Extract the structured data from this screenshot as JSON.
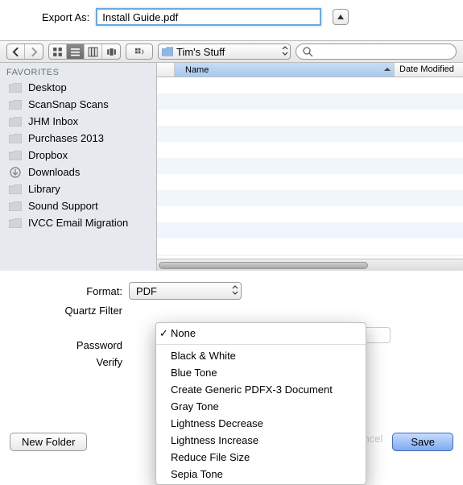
{
  "header": {
    "export_label": "Export As:",
    "filename": "Install Guide.pdf"
  },
  "toolbar": {
    "path_folder": "Tim's Stuff"
  },
  "sidebar": {
    "section_label": "FAVORITES",
    "items": [
      {
        "label": "Desktop",
        "icon": "folder"
      },
      {
        "label": "ScanSnap Scans",
        "icon": "folder"
      },
      {
        "label": "JHM Inbox",
        "icon": "folder"
      },
      {
        "label": "Purchases 2013",
        "icon": "folder"
      },
      {
        "label": "Dropbox",
        "icon": "folder"
      },
      {
        "label": "Downloads",
        "icon": "download"
      },
      {
        "label": "Library",
        "icon": "folder"
      },
      {
        "label": "Sound Support",
        "icon": "folder"
      },
      {
        "label": "IVCC Email Migration",
        "icon": "folder"
      }
    ]
  },
  "columns": {
    "name": "Name",
    "date_modified": "Date Modified"
  },
  "form": {
    "format_label": "Format:",
    "format_value": "PDF",
    "quartz_label": "Quartz Filter",
    "password_label": "Password",
    "verify_label": "Verify"
  },
  "quartz_options": [
    "None",
    "Black & White",
    "Blue Tone",
    "Create Generic PDFX-3 Document",
    "Gray Tone",
    "Lightness Decrease",
    "Lightness Increase",
    "Reduce File Size",
    "Sepia Tone"
  ],
  "quartz_selected": "None",
  "buttons": {
    "new_folder": "New Folder",
    "cancel": "Cancel",
    "save": "Save"
  }
}
